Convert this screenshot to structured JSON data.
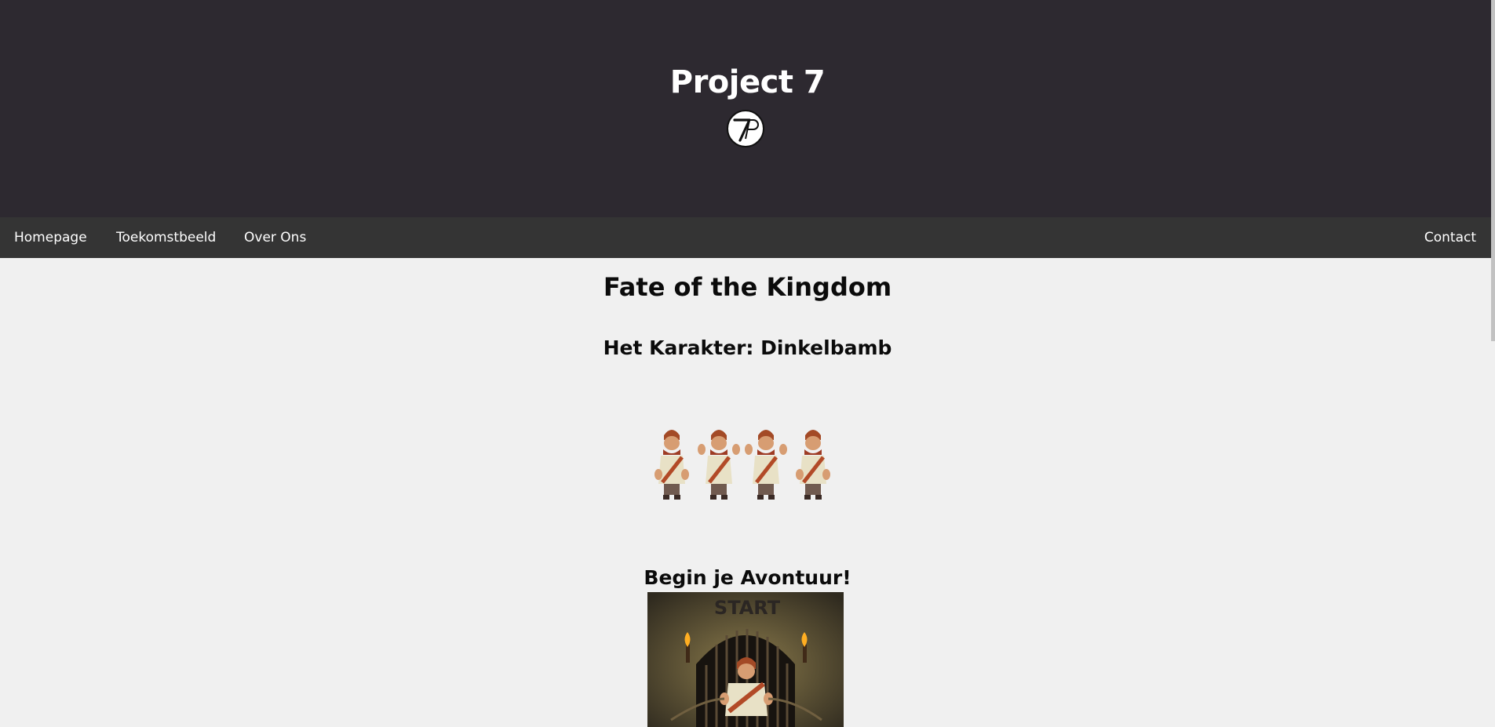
{
  "header": {
    "title": "Project 7",
    "logo_text": "7P",
    "background_color": "#2d2930"
  },
  "nav": {
    "items": [
      {
        "label": "Homepage"
      },
      {
        "label": "Toekomstbeeld"
      },
      {
        "label": "Over Ons"
      },
      {
        "label": "Contact"
      }
    ],
    "background_color": "#343434"
  },
  "main": {
    "page_title": "Fate of the Kingdom",
    "character_heading": "Het Karakter: Dinkelbamb",
    "sprites_icon": "character-sprite-icon",
    "adventure_heading": "Begin je Avontuur!",
    "start_image_text": "START",
    "background_color": "#f0f0f0"
  }
}
